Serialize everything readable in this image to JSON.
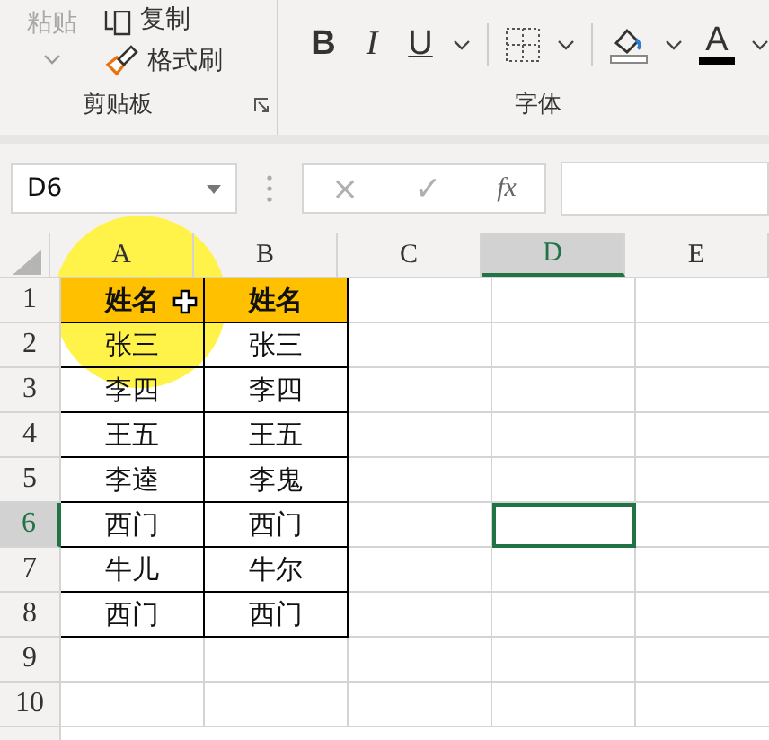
{
  "ribbon": {
    "clipboard": {
      "paste": "粘贴",
      "copy": "复制",
      "format_painter": "格式刷",
      "label": "剪贴板"
    },
    "font": {
      "bold": "B",
      "italic": "I",
      "underline": "U",
      "font_color": "A",
      "label": "字体"
    }
  },
  "formula_bar": {
    "name_box": "D6",
    "cancel": "×",
    "enter": "✓",
    "function": "fx"
  },
  "columns": [
    {
      "label": "A",
      "selected": false
    },
    {
      "label": "B",
      "selected": false
    },
    {
      "label": "C",
      "selected": false
    },
    {
      "label": "D",
      "selected": true
    },
    {
      "label": "E",
      "selected": false
    }
  ],
  "rows": [
    {
      "number": "1",
      "selected": false,
      "kind": "header",
      "cells": [
        "姓名",
        "姓名"
      ]
    },
    {
      "number": "2",
      "selected": false,
      "kind": "data",
      "cells": [
        "张三",
        "张三"
      ]
    },
    {
      "number": "3",
      "selected": false,
      "kind": "data",
      "cells": [
        "李四",
        "李四"
      ]
    },
    {
      "number": "4",
      "selected": false,
      "kind": "data",
      "cells": [
        "王五",
        "王五"
      ]
    },
    {
      "number": "5",
      "selected": false,
      "kind": "data",
      "cells": [
        "李逵",
        "李鬼"
      ]
    },
    {
      "number": "6",
      "selected": true,
      "kind": "data",
      "cells": [
        "西门",
        "西门"
      ]
    },
    {
      "number": "7",
      "selected": false,
      "kind": "data",
      "cells": [
        "牛儿",
        "牛尔"
      ]
    },
    {
      "number": "8",
      "selected": false,
      "kind": "data",
      "cells": [
        "西门",
        "西门"
      ]
    },
    {
      "number": "9",
      "selected": false,
      "kind": "empty",
      "cells": []
    },
    {
      "number": "10",
      "selected": false,
      "kind": "empty",
      "cells": []
    }
  ]
}
